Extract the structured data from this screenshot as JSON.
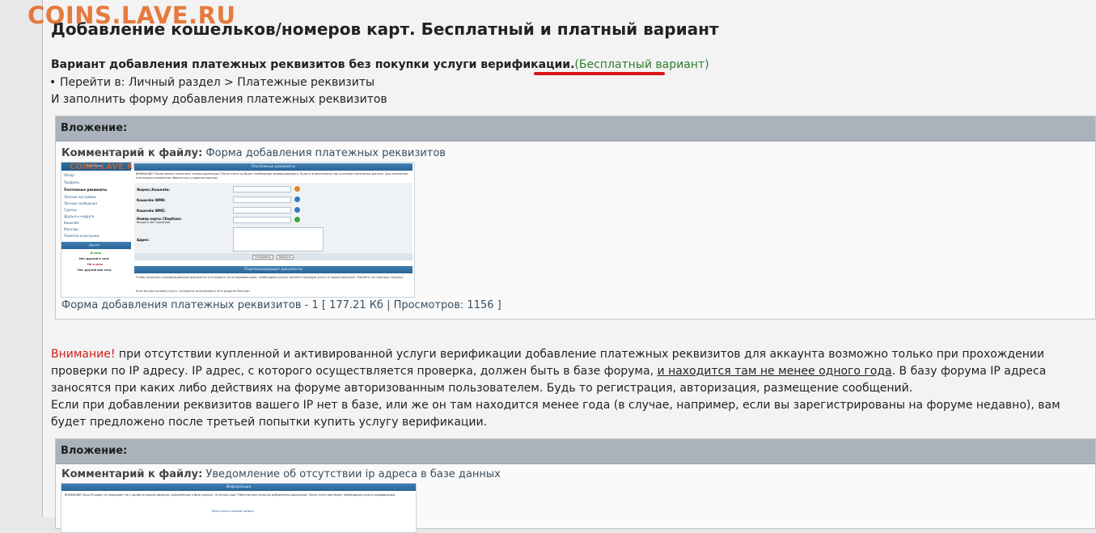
{
  "watermark": "COINS.LAVE.RU",
  "title": "Добавление кошельков/номеров карт. Бесплатный и платный вариант",
  "intro": {
    "bold_text": "Вариант добавления платежных реквизитов без покупки услуги верификации.",
    "free_link": "(Бесплатный вариант)"
  },
  "bullet": "Перейти в: Личный раздел > Платежные реквизиты",
  "fill_form": "И заполнить форму добавления платежных реквизитов",
  "attachment1": {
    "header": "Вложение:",
    "comment_label": "Комментарий к файлу:",
    "comment_text": " Форма добавления платежных реквизитов",
    "file_info": "Форма добавления платежных реквизитов - 1 [ 177.21 Кб | Просмотров: 1156 ]",
    "thumb": {
      "watermark": "COINS.LAVE.RU",
      "sidebar_head": "Навигация",
      "sidebar_items": [
        "Обзор",
        "Профиль",
        "Платежные реквизиты",
        "Личные настройки",
        "Личные сообщения",
        "Группы",
        "Друзья и недруги",
        "Кошелёк",
        "Магазин",
        "Пометки и рассылки"
      ],
      "friends_head": "Друзья",
      "friends_online": "В сети",
      "friends_none1": "Нет друзей в сети",
      "friends_offline": "Не в сети",
      "friends_none2": "Нет друзей вне сети",
      "main_head": "Платёжные реквизиты",
      "warning_text": "ВНИМАНИЕ! После можно заполнить только единожды! После этого их будет необходимо верифицировать. Будьте внимательны при указании платежных данных. Для изменения платежных реквизитов обратитесь к администратору.",
      "fields": [
        "Яндекс.Кошелёк:",
        "Кошелёк WMR:",
        "Кошелёк WMZ:",
        "Номер карты Сбербанк:",
        "Адрес:"
      ],
      "field_hint": "Вводить без пробелов",
      "btn_send": "Отправить",
      "btn_reset": "Вернуть",
      "docs_head": "Подтверждающие документы",
      "docs_text": "Чтобы загрузить подтверждающие документы и отправить их на верификацию, необходимо купить соответствующую услугу в нашем магазине. Перейти на страницу покупки.",
      "docs_text2": "Если вы уже купили услугу, то можете использовать её в разделе Магазин."
    }
  },
  "warning": {
    "label": "Внимание!",
    "text1": " при отсутствии купленной и активированной услуги верификации добавление платежных реквизитов для аккаунта возможно только при прохождении проверки по IP адресу. IP адрес, с которого осуществляется проверка, должен быть в базе форума, ",
    "underlined": "и находится там не менее одного года",
    "text2": ". В базу форума IP адреса заносятся при каких либо действиях на форуме авторизованным пользователем. Будь то регистрация, авторизация, размещение сообщений.",
    "text3": "Если при добавлении реквизитов вашего IP нет в базе, или же он там находится менее года (в случае, например, если вы зарегистрированы на форуме недавно), вам будет предложено после третьей попытки купить услугу верификации."
  },
  "attachment2": {
    "header": "Вложение:",
    "comment_label": "Комментарий к файлу:",
    "comment_text": " Уведомление об отсутствии ip адреса в базе данных",
    "thumb": {
      "head": "Информация",
      "text": "ВНИМАНИЕ! Ваш IP-адрес не совпадает ни с одним из ваших адресов, сохранённых в базе данных. Осталось ещё 3 бесплатных попыток добавления кошельков. После этого вам будет необходимо купить верификацию.",
      "link": "Вернуться в личный раздел"
    }
  }
}
